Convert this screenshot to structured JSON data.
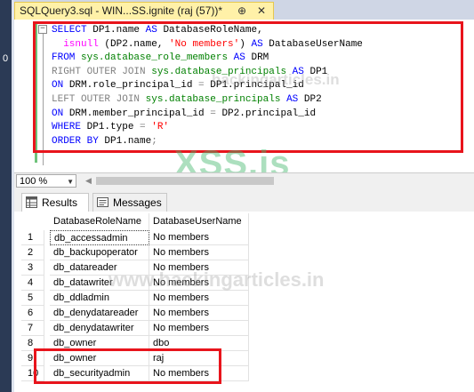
{
  "window": {
    "tab_title": "SQLQuery3.sql - WIN...SS.ignite (raj (57))*",
    "pin_glyph": "⊕",
    "close_glyph": "✕",
    "left_margin_digit": "0"
  },
  "editor": {
    "fold_glyph": "−",
    "lines": [
      [
        {
          "t": "SELECT ",
          "c": "kw"
        },
        {
          "t": "DP1.name ",
          "c": "blk"
        },
        {
          "t": "AS ",
          "c": "kw"
        },
        {
          "t": "DatabaseRoleName,",
          "c": "blk"
        }
      ],
      [
        {
          "t": "  isnull ",
          "c": "fn"
        },
        {
          "t": "(DP2.name, ",
          "c": "blk"
        },
        {
          "t": "'No members'",
          "c": "str"
        },
        {
          "t": ") ",
          "c": "blk"
        },
        {
          "t": "AS ",
          "c": "kw"
        },
        {
          "t": "DatabaseUserName",
          "c": "blk"
        }
      ],
      [
        {
          "t": "FROM ",
          "c": "kw"
        },
        {
          "t": "sys.database_role_members ",
          "c": "sys"
        },
        {
          "t": "AS ",
          "c": "kw"
        },
        {
          "t": "DRM",
          "c": "blk"
        }
      ],
      [
        {
          "t": "RIGHT OUTER JOIN ",
          "c": "gry"
        },
        {
          "t": "sys.database_principals ",
          "c": "sys"
        },
        {
          "t": "AS ",
          "c": "kw"
        },
        {
          "t": "DP1",
          "c": "blk"
        }
      ],
      [
        {
          "t": "ON ",
          "c": "kw"
        },
        {
          "t": "DRM.role_principal_id ",
          "c": "blk"
        },
        {
          "t": "= ",
          "c": "gry"
        },
        {
          "t": "DP1.principal_id",
          "c": "blk"
        }
      ],
      [
        {
          "t": "LEFT OUTER JOIN ",
          "c": "gry"
        },
        {
          "t": "sys.database_principals ",
          "c": "sys"
        },
        {
          "t": "AS ",
          "c": "kw"
        },
        {
          "t": "DP2",
          "c": "blk"
        }
      ],
      [
        {
          "t": "ON ",
          "c": "kw"
        },
        {
          "t": "DRM.member_principal_id ",
          "c": "blk"
        },
        {
          "t": "= ",
          "c": "gry"
        },
        {
          "t": "DP2.principal_id",
          "c": "blk"
        }
      ],
      [
        {
          "t": "WHERE ",
          "c": "kw"
        },
        {
          "t": "DP1.type ",
          "c": "blk"
        },
        {
          "t": "= ",
          "c": "gry"
        },
        {
          "t": "'R'",
          "c": "str"
        }
      ],
      [
        {
          "t": "ORDER BY ",
          "c": "kw"
        },
        {
          "t": "DP1.name",
          "c": "blk"
        },
        {
          "t": ";",
          "c": "gry"
        }
      ]
    ]
  },
  "watermarks": {
    "top": "hackingarticles.in",
    "middle": "XSS.is",
    "bottom": "www.hackingarticles.in"
  },
  "zoom": {
    "value": "100 %",
    "arrow": "▼",
    "scroll_left": "◀"
  },
  "results_tabs": {
    "results_label": "Results",
    "messages_label": "Messages"
  },
  "grid": {
    "columns": [
      "DatabaseRoleName",
      "DatabaseUserName"
    ],
    "rows": [
      {
        "num": "1",
        "role": "db_accessadmin",
        "user": "No members"
      },
      {
        "num": "2",
        "role": "db_backupoperator",
        "user": "No members"
      },
      {
        "num": "3",
        "role": "db_datareader",
        "user": "No members"
      },
      {
        "num": "4",
        "role": "db_datawriter",
        "user": "No members"
      },
      {
        "num": "5",
        "role": "db_ddladmin",
        "user": "No members"
      },
      {
        "num": "6",
        "role": "db_denydatareader",
        "user": "No members"
      },
      {
        "num": "7",
        "role": "db_denydatawriter",
        "user": "No members"
      },
      {
        "num": "8",
        "role": "db_owner",
        "user": "dbo"
      },
      {
        "num": "9",
        "role": "db_owner",
        "user": "raj"
      },
      {
        "num": "10",
        "role": "db_securityadmin",
        "user": "No members"
      }
    ]
  },
  "colors": {
    "highlight_box": "#e8141c",
    "tab_active": "#fff1a8",
    "keyword": "#0000ff",
    "system_object": "#008000",
    "string": "#ff0000",
    "function": "#ff00ff"
  }
}
